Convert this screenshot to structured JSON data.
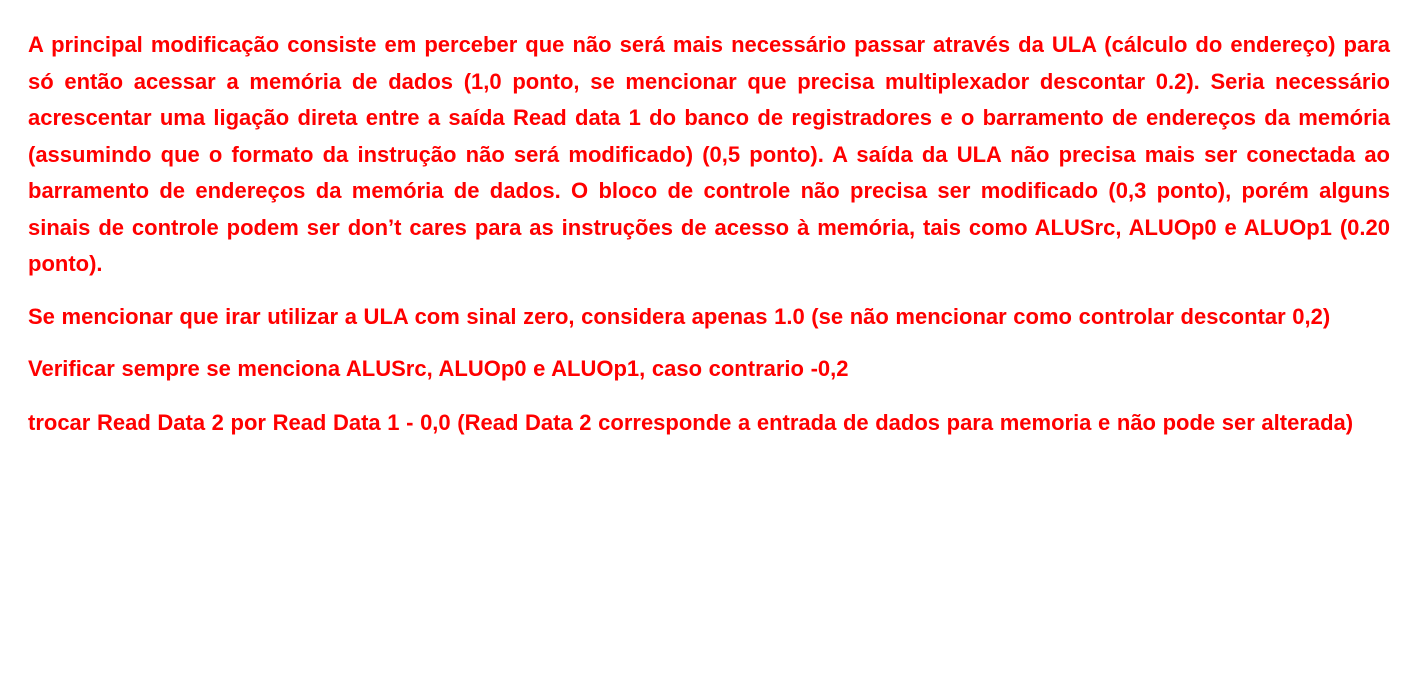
{
  "document": {
    "paragraphs": [
      "A principal modificação consiste em perceber que não será mais necessário passar através da ULA (cálculo do endereço) para só então acessar a memória de dados (1,0 ponto, se mencionar que precisa multiplexador descontar 0.2). Seria necessário acrescentar uma ligação direta entre a saída Read data 1 do banco de registradores e o barramento de endereços da memória (assumindo que o formato da instrução não será modificado) (0,5 ponto). A saída da ULA não precisa mais ser conectada ao barramento de endereços da memória de dados. O bloco de controle não precisa ser modificado (0,3 ponto), porém alguns sinais de controle podem ser don’t cares para as instruções de acesso à memória, tais como ALUSrc, ALUOp0 e ALUOp1 (0.20 ponto).",
      "Se mencionar que irar utilizar a ULA com sinal zero, considera apenas 1.0 (se não mencionar como controlar descontar 0,2)",
      "Verificar sempre se menciona ALUSrc, ALUOp0 e ALUOp1, caso contrario -0,2",
      "trocar Read Data 2 por Read Data 1 - 0,0 (Read Data 2 corresponde a entrada de dados para memoria e não pode ser alterada)"
    ],
    "text_color": "#ff0000",
    "background_color": "#ffffff"
  }
}
